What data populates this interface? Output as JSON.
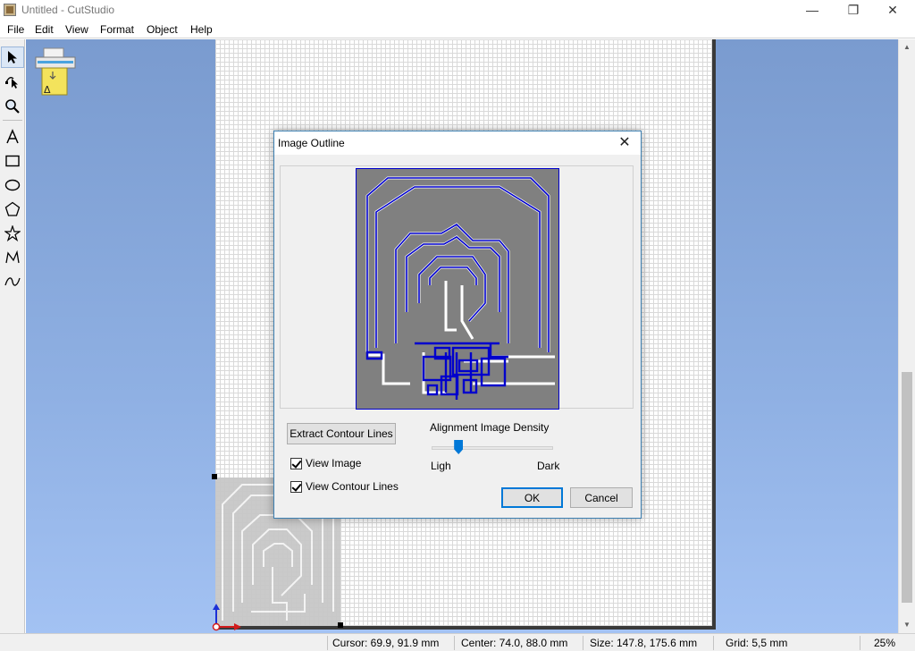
{
  "window": {
    "title": "Untitled - CutStudio",
    "minimize_glyph": "—",
    "maximize_glyph": "❐",
    "close_glyph": "✕"
  },
  "menu": {
    "items": [
      "File",
      "Edit",
      "View",
      "Format",
      "Object",
      "Help"
    ]
  },
  "toolbar": {
    "tools": [
      "select-tool",
      "node-edit-tool",
      "zoom-tool",
      "text-tool",
      "rectangle-tool",
      "ellipse-tool",
      "polygon-tool",
      "star-tool",
      "polyline-tool",
      "curve-tool"
    ],
    "active_tool": "select-tool"
  },
  "dialog": {
    "title": "Image Outline",
    "extract_button": "Extract Contour Lines",
    "view_image_label": "View Image",
    "view_image_checked": true,
    "view_contour_label": "View Contour Lines",
    "view_contour_checked": true,
    "density_label": "Alignment Image Density",
    "density_min_label": "Ligh",
    "density_max_label": "Dark",
    "density_value": 0.2,
    "ok_button": "OK",
    "cancel_button": "Cancel"
  },
  "status": {
    "cursor": "Cursor: 69.9, 91.9 mm",
    "center": "Center: 74.0, 88.0 mm",
    "size": "Size: 147.8, 175.6 mm",
    "grid": "Grid: 5,5 mm",
    "zoom": "25%"
  },
  "colors": {
    "accent": "#0078d7",
    "workspace": "#8fb0e3",
    "contour": "#0000cc",
    "image_bg": "#808080"
  }
}
